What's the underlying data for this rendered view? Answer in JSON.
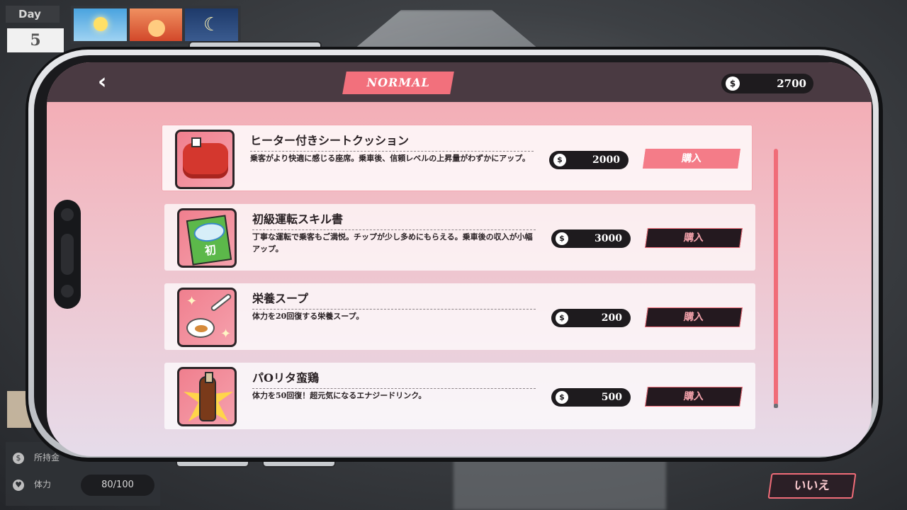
{
  "hud": {
    "day_label": "Day",
    "day_number": "5",
    "time_phases": [
      "morning",
      "evening",
      "night"
    ],
    "stat_money_label": "所持金",
    "stat_stamina_label": "体力",
    "stamina_value": "80/100"
  },
  "header": {
    "mode": "NORMAL",
    "money": "2700",
    "back_icon": "chevron-left-icon",
    "coin_symbol": "$"
  },
  "shop": {
    "items": [
      {
        "name": "ヒーター付きシートクッション",
        "description": "乗客がより快適に感じる座席。乗車後、信頼レベルの上昇量がわずかにアップ。",
        "price": "2000",
        "buy_label": "購入",
        "selected": true,
        "icon": "seat-cushion-icon"
      },
      {
        "name": "初級運転スキル書",
        "description": "丁寧な運転で乗客もご満悦。チップが少し多めにもらえる。乗車後の収入が小幅アップ。",
        "price": "3000",
        "buy_label": "購入",
        "selected": false,
        "icon": "skill-book-icon",
        "book_glyph": "初"
      },
      {
        "name": "栄養スープ",
        "description": "体力を20回復する栄養スープ。",
        "price": "200",
        "buy_label": "購入",
        "selected": false,
        "icon": "soup-spoon-icon"
      },
      {
        "name": "パOリタ蛮鶏",
        "description": "体力を50回復！超元気になるエナジードリンク。",
        "price": "500",
        "buy_label": "購入",
        "selected": false,
        "icon": "energy-drink-icon"
      }
    ]
  },
  "footer": {
    "no_label": "いいえ"
  },
  "colors": {
    "accent": "#f2707c",
    "header_bg": "#4a3a42",
    "price_bg": "#1e1b1e"
  }
}
